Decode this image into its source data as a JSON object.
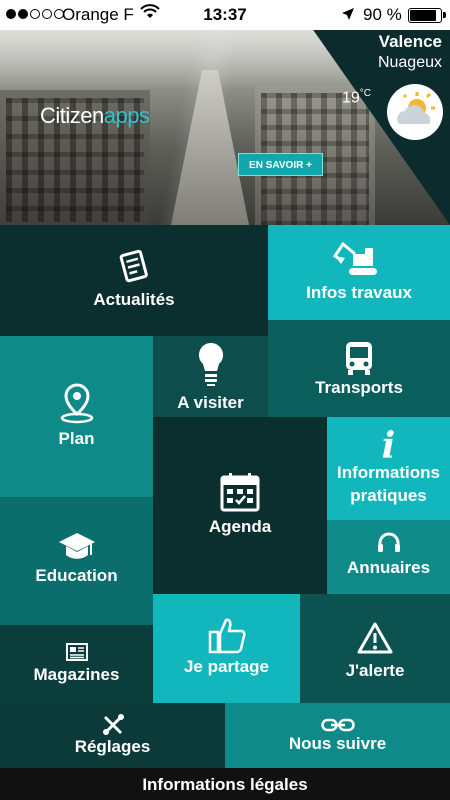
{
  "status_bar": {
    "carrier": "Orange F",
    "time": "13:37",
    "battery_percent": "90 %",
    "battery_level": 0.9,
    "signal_bars_filled": 2,
    "signal_bars_total": 5
  },
  "hero": {
    "logo_part1": "Citizen",
    "logo_part2": "apps",
    "cta_label": "EN SAVOIR +",
    "weather": {
      "city": "Valence",
      "condition": "Nuageux",
      "temperature": "19",
      "unit": "°C",
      "icon": "partly-cloudy-icon"
    }
  },
  "tiles": [
    {
      "key": "actualites",
      "label": "Actualités",
      "icon": "news-icon",
      "color": "#0b2f2e"
    },
    {
      "key": "infos_travaux",
      "label": "Infos travaux",
      "icon": "excavator-icon",
      "color": "#12b7bd"
    },
    {
      "key": "a_visiter",
      "label": "A visiter",
      "icon": "lightbulb-icon",
      "color": "#0d4e4c"
    },
    {
      "key": "transports",
      "label": "Transports",
      "icon": "bus-icon",
      "color": "#0a5e5c"
    },
    {
      "key": "plan",
      "label": "Plan",
      "icon": "map-pin-icon",
      "color": "#0e8a88"
    },
    {
      "key": "informations_pratiques",
      "label": "Informations pratiques",
      "label_line1": "Informations",
      "label_line2": "pratiques",
      "icon": "info-icon",
      "color": "#12b7bd"
    },
    {
      "key": "agenda",
      "label": "Agenda",
      "icon": "calendar-icon",
      "color": "#0b2f2e"
    },
    {
      "key": "annuaires",
      "label": "Annuaires",
      "icon": "headset-icon",
      "color": "#0e8a88"
    },
    {
      "key": "education",
      "label": "Education",
      "icon": "graduation-cap-icon",
      "color": "#0b6e6c"
    },
    {
      "key": "je_partage",
      "label": "Je partage",
      "icon": "thumbs-up-icon",
      "color": "#12b7bd"
    },
    {
      "key": "magazines",
      "label": "Magazines",
      "icon": "newspaper-icon",
      "color": "#0b3d3c"
    },
    {
      "key": "jalerte",
      "label": "J'alerte",
      "icon": "warning-icon",
      "color": "#0b5250"
    },
    {
      "key": "reglages",
      "label": "Réglages",
      "icon": "tools-icon",
      "color": "#0b3a39"
    },
    {
      "key": "nous_suivre",
      "label": "Nous suivre",
      "icon": "link-icon",
      "color": "#0e8a88"
    }
  ],
  "footer": {
    "label": "Informations légales"
  }
}
